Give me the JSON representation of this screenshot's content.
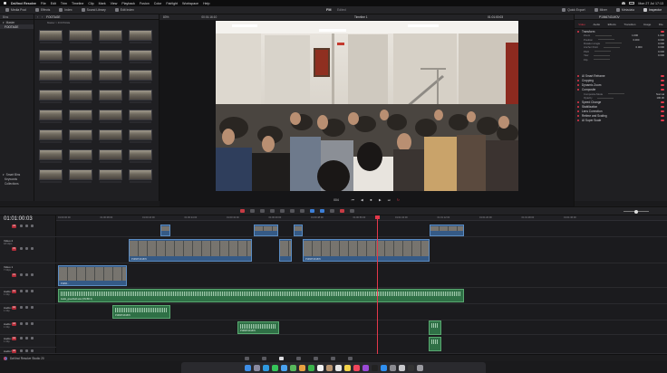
{
  "menubar": {
    "app": "DaVinci Resolve",
    "items": [
      "File",
      "Edit",
      "Trim",
      "Timeline",
      "Clip",
      "Mark",
      "View",
      "Playback",
      "Fusion",
      "Color",
      "Fairlight",
      "Workspace",
      "Help"
    ],
    "datetime": "Mon 27 Jul 17:13"
  },
  "toolbar": {
    "left": [
      "Media Pool",
      "Effects",
      "Index",
      "Sound Library",
      "Edit Index"
    ],
    "project_title": "FM",
    "project_status": "Edited",
    "right": [
      "Quick Export",
      "Mixer",
      "Metadata",
      "Inspector"
    ]
  },
  "bins": {
    "header": "Bins",
    "items": [
      "Master",
      "FOOTAGE"
    ],
    "selected": "FOOTAGE",
    "smart_header": "Smart Bins",
    "smart_items": [
      "Keywords",
      "Collections"
    ]
  },
  "media_pool": {
    "path": "FOOTAGE",
    "crumb": "Master > FOOTAGE",
    "thumb_count": 32
  },
  "viewer": {
    "zoom": "83%",
    "timecode_left": "00:01:16:10",
    "timeline_name": "Timeline 1",
    "timecode_right": "01:01:00:03",
    "duration": "004"
  },
  "inspector": {
    "clip_name": "P1066743.MOV",
    "tabs": [
      "Video",
      "Audio",
      "Effects",
      "Transition",
      "Image",
      "File"
    ],
    "selected_tab": "Video",
    "sections": [
      {
        "name": "Transform",
        "props": [
          {
            "name": "Zoom",
            "v": "1.000",
            "v2": "1.000"
          },
          {
            "name": "Position",
            "v": "0.000",
            "v2": "0.000"
          },
          {
            "name": "Rotation Angle",
            "v": "0.000"
          },
          {
            "name": "Anchor Point",
            "v": "0.000",
            "v2": "0.000"
          },
          {
            "name": "Pitch",
            "v": "0.000"
          },
          {
            "name": "Yaw",
            "v": "0.000"
          },
          {
            "name": "Flip",
            "v": ""
          }
        ]
      },
      {
        "name": "AI Smart Reframe",
        "props": []
      },
      {
        "name": "Cropping",
        "props": []
      },
      {
        "name": "Dynamic Zoom",
        "props": []
      },
      {
        "name": "Composite",
        "props": [
          {
            "name": "Composite Mode",
            "v": "Normal"
          },
          {
            "name": "Opacity",
            "v": "100.00"
          }
        ]
      },
      {
        "name": "Speed Change",
        "props": []
      },
      {
        "name": "Stabilization",
        "props": []
      },
      {
        "name": "Lens Correction",
        "props": []
      },
      {
        "name": "Retime and Scaling",
        "props": []
      },
      {
        "name": "AI Super Scale",
        "props": []
      }
    ]
  },
  "timeline": {
    "timecode": "01:01:00:03",
    "ruler": [
      "01:00:00:00",
      "01:00:08:00",
      "01:00:16:00",
      "01:00:24:00",
      "01:00:32:00",
      "01:00:40:00",
      "01:00:48:00",
      "01:00:56:00",
      "01:01:04:00",
      "01:01:12:00",
      "01:01:20:00",
      "01:01:28:00",
      "01:01:36:00"
    ],
    "tracks": [
      {
        "badge": "V3",
        "name": "",
        "sub": ""
      },
      {
        "badge": "V2",
        "name": "Video 2",
        "sub": "18 Clips"
      },
      {
        "badge": "V1",
        "name": "Video 1",
        "sub": "7 Clips"
      },
      {
        "badge": "A1",
        "name": "Audio 1",
        "sub": "1 Clip"
      },
      {
        "badge": "A2",
        "name": "Audio 2",
        "sub": "1 Clip"
      },
      {
        "badge": "A3",
        "name": "Audio 3",
        "sub": "1 Clip"
      },
      {
        "badge": "A4",
        "name": "Audio 4",
        "sub": "1 Clip"
      },
      {
        "badge": "A5",
        "name": "Audio 5",
        "sub": ""
      }
    ],
    "clips": {
      "v2_label": "P1066743.MOV",
      "v1_label": "P1066...",
      "a1_label": "Audio_greenfield.wav (ON BR 3)",
      "a2_label": "P1066743.MOV",
      "a3_label": "P1066743.MOV"
    }
  },
  "footer": {
    "app_label": "DaVinci Resolve Studio 20"
  }
}
